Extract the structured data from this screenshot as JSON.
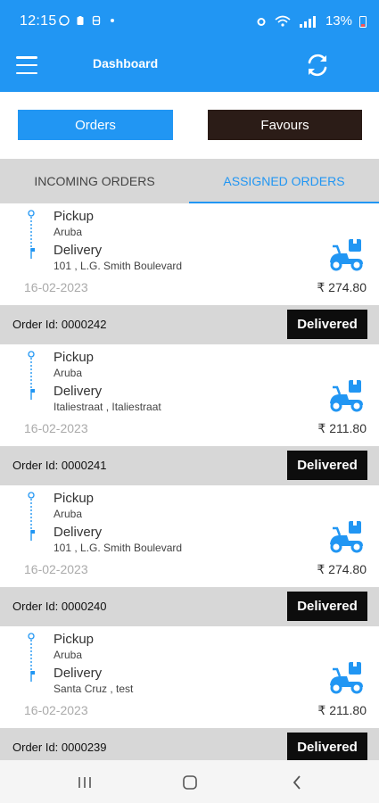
{
  "status_bar": {
    "time": "12:15",
    "battery": "13%"
  },
  "app_bar": {
    "title": "Dashboard",
    "menu_icon": "hamburger-menu-icon",
    "refresh_icon": "refresh-icon"
  },
  "segments": {
    "orders": "Orders",
    "favours": "Favours"
  },
  "tabs": {
    "incoming": "INCOMING ORDERS",
    "assigned": "ASSIGNED ORDERS",
    "active": "assigned"
  },
  "colors": {
    "primary": "#2196f3",
    "favours_bg": "#2b1c17",
    "badge_bg": "#0d0d0d",
    "footer_bg": "#d7d7d7"
  },
  "orders": [
    {
      "pickup_label": "Pickup",
      "pickup_place": "Aruba",
      "delivery_label": "Delivery",
      "delivery_address": "101 , L.G. Smith Boulevard",
      "date": "16-02-2023",
      "price": "₹ 274.80",
      "order_id": "Order Id: 0000242",
      "status": "Delivered"
    },
    {
      "pickup_label": "Pickup",
      "pickup_place": "Aruba",
      "delivery_label": "Delivery",
      "delivery_address": "Italiestraat , Italiestraat",
      "date": "16-02-2023",
      "price": "₹ 211.80",
      "order_id": "Order Id: 0000241",
      "status": "Delivered"
    },
    {
      "pickup_label": "Pickup",
      "pickup_place": "Aruba",
      "delivery_label": "Delivery",
      "delivery_address": "101 , L.G. Smith Boulevard",
      "date": "16-02-2023",
      "price": "₹ 274.80",
      "order_id": "Order Id: 0000240",
      "status": "Delivered"
    },
    {
      "pickup_label": "Pickup",
      "pickup_place": "Aruba",
      "delivery_label": "Delivery",
      "delivery_address": "Santa Cruz , test",
      "date": "16-02-2023",
      "price": "₹ 211.80",
      "order_id": "Order Id: 0000239",
      "status": "Delivered"
    }
  ],
  "nav_bar": {
    "recent_icon": "recent-apps-icon",
    "home_icon": "home-icon",
    "back_icon": "back-icon"
  }
}
